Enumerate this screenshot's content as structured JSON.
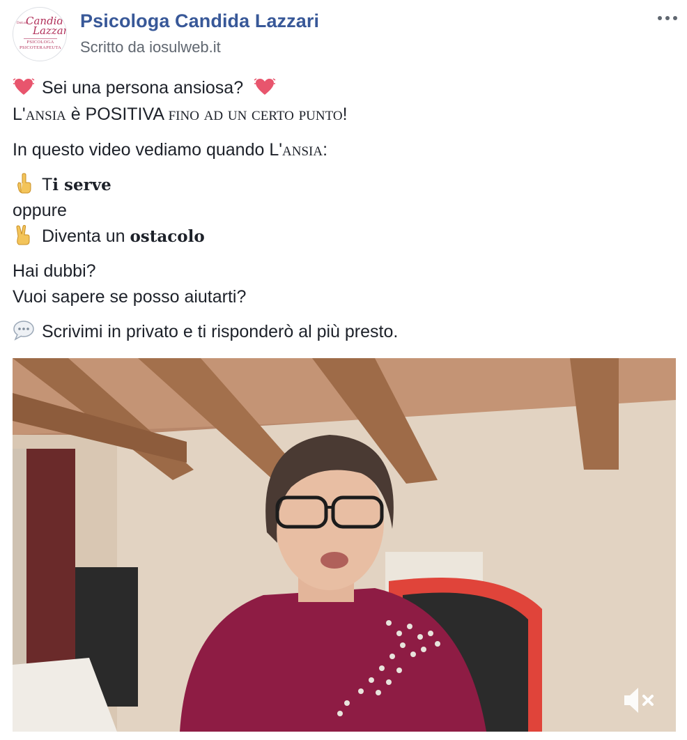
{
  "post": {
    "page_name": "Psicologa Candida Lazzari",
    "byline_prefix": "Scritto da",
    "byline_link": "iosulweb.it",
    "avatar": {
      "script_line1": "Candida",
      "script_line2": "Lazzari",
      "tiny": "Dott.ssa",
      "sub_line1": "PSICOLOGA",
      "sub_line2": "PSICOTERAPEUTA"
    },
    "more_icon": "ellipsis-icon",
    "body": {
      "line1": "Sei una persona ansiosa?",
      "line2_prefix": "L'",
      "line2_sc1": "ansia",
      "line2_mid": " è POSITIVA ",
      "line2_sc2": "fino ad un certo punto",
      "line2_suffix": "!",
      "line3_prefix": "In questo video vediamo quando L'",
      "line3_sc": "ansia",
      "line3_suffix": ":",
      "line4_prefix": "T",
      "line4_bold": "i serve",
      "line5": "oppure",
      "line6_prefix": "Diventa un ",
      "line6_bold": "ostacolo",
      "line7": "Hai dubbi?",
      "line8": "Vuoi sapere se posso aiutarti?",
      "line9": "Scrivimi in privato e ti risponderò al più presto."
    },
    "emoji_icons": [
      "beating-heart-icon",
      "pointing-up-icon",
      "victory-hand-icon",
      "speech-balloon-icon"
    ],
    "video": {
      "mute_icon": "speaker-muted-icon"
    }
  },
  "colors": {
    "page_name": "#385898",
    "secondary_text": "#606770",
    "body_text": "#1d2129",
    "shirt": "#8e1c44",
    "chair_red": "#e0443a"
  }
}
